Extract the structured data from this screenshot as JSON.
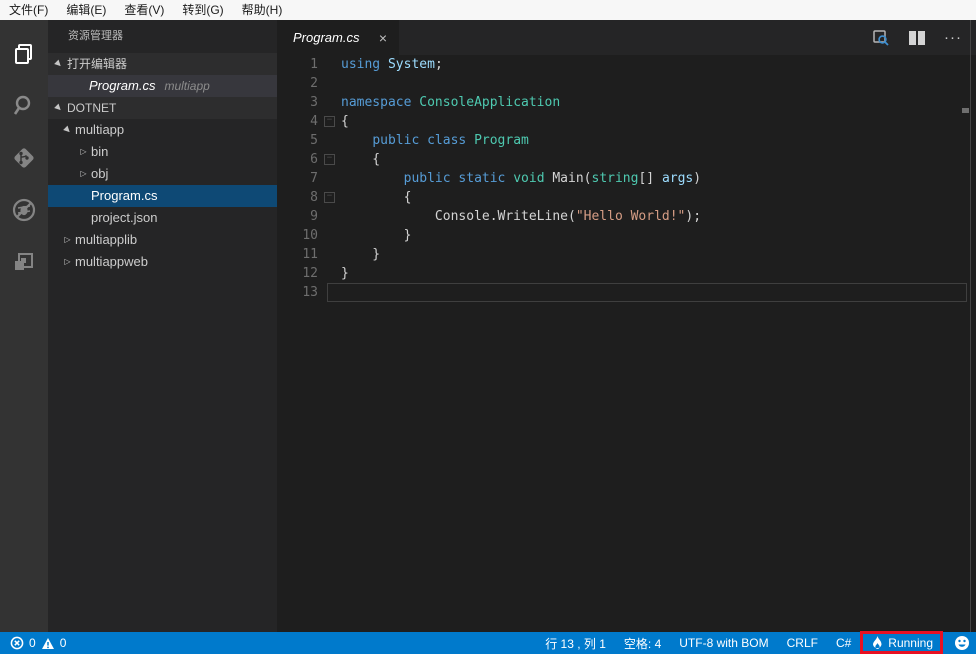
{
  "menu_bar": {
    "items": [
      "文件(F)",
      "编辑(E)",
      "查看(V)",
      "转到(G)",
      "帮助(H)"
    ]
  },
  "activity_bar": {
    "items": [
      {
        "name": "explorer",
        "active": true
      },
      {
        "name": "search",
        "active": false
      },
      {
        "name": "source-control",
        "active": false
      },
      {
        "name": "debug",
        "active": false
      },
      {
        "name": "extensions",
        "active": false
      }
    ]
  },
  "sidebar": {
    "title": "资源管理器",
    "open_editors_header": "打开编辑器",
    "open_editors": [
      {
        "file": "Program.cs",
        "detail": "multiapp"
      }
    ],
    "folder_header": "DOTNET",
    "tree": [
      {
        "label": "multiapp",
        "kind": "folder-open",
        "level": 1
      },
      {
        "label": "bin",
        "kind": "folder-closed",
        "level": 2
      },
      {
        "label": "obj",
        "kind": "folder-closed",
        "level": 2
      },
      {
        "label": "Program.cs",
        "kind": "file",
        "level": 2,
        "selected": true
      },
      {
        "label": "project.json",
        "kind": "file",
        "level": 2
      },
      {
        "label": "multiapplib",
        "kind": "folder-closed",
        "level": 1
      },
      {
        "label": "multiappweb",
        "kind": "folder-closed",
        "level": 1
      }
    ]
  },
  "editor": {
    "tab": {
      "title": "Program.cs",
      "close": "×"
    },
    "more_actions": "···",
    "lines": [
      {
        "num": 1,
        "tokens": [
          [
            "kw",
            "using"
          ],
          [
            "pl",
            " "
          ],
          [
            "var",
            "System"
          ],
          [
            "pl",
            ";"
          ]
        ]
      },
      {
        "num": 2,
        "tokens": []
      },
      {
        "num": 3,
        "tokens": [
          [
            "kw",
            "namespace"
          ],
          [
            "pl",
            " "
          ],
          [
            "type",
            "ConsoleApplication"
          ]
        ]
      },
      {
        "num": 4,
        "tokens": [
          [
            "pl",
            "{"
          ]
        ],
        "fold": true
      },
      {
        "num": 5,
        "tokens": [
          [
            "pl",
            "    "
          ],
          [
            "kw",
            "public"
          ],
          [
            "pl",
            " "
          ],
          [
            "kw",
            "class"
          ],
          [
            "pl",
            " "
          ],
          [
            "type",
            "Program"
          ]
        ]
      },
      {
        "num": 6,
        "tokens": [
          [
            "pl",
            "    {"
          ]
        ],
        "fold": true
      },
      {
        "num": 7,
        "tokens": [
          [
            "pl",
            "        "
          ],
          [
            "kw",
            "public"
          ],
          [
            "pl",
            " "
          ],
          [
            "kw",
            "static"
          ],
          [
            "pl",
            " "
          ],
          [
            "type",
            "void"
          ],
          [
            "pl",
            " Main("
          ],
          [
            "type",
            "string"
          ],
          [
            "pl",
            "[] "
          ],
          [
            "var",
            "args"
          ],
          [
            "pl",
            ")"
          ]
        ]
      },
      {
        "num": 8,
        "tokens": [
          [
            "pl",
            "        {"
          ]
        ],
        "fold": true
      },
      {
        "num": 9,
        "tokens": [
          [
            "pl",
            "            Console.WriteLine("
          ],
          [
            "str",
            "\"Hello World!\""
          ],
          [
            "pl",
            ");"
          ]
        ]
      },
      {
        "num": 10,
        "tokens": [
          [
            "pl",
            "        }"
          ]
        ]
      },
      {
        "num": 11,
        "tokens": [
          [
            "pl",
            "    }"
          ]
        ]
      },
      {
        "num": 12,
        "tokens": [
          [
            "pl",
            "}"
          ]
        ]
      },
      {
        "num": 13,
        "tokens": [],
        "current": true
      }
    ]
  },
  "status_bar": {
    "errors": "0",
    "warnings": "0",
    "cursor": "行 13 , 列 1",
    "indent": "空格: 4",
    "encoding": "UTF-8 with BOM",
    "eol": "CRLF",
    "language": "C#",
    "running": "Running"
  },
  "annotation": {
    "shape": "red-box",
    "color": "#e81123",
    "around": "running-status"
  },
  "colors": {
    "status_bar": "#007acc",
    "selection": "#0e4975",
    "editor_bg": "#1e1e1e",
    "sidebar_bg": "#252526",
    "activity_bar_bg": "#333333",
    "keyword": "#569cd6",
    "type": "#4ec9b0",
    "string": "#d69d85"
  }
}
